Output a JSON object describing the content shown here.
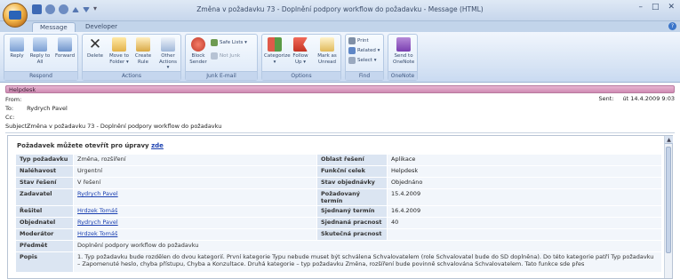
{
  "window": {
    "title": "Změna v požadavku 73 - Doplnění podpory workflow do požadavku - Message (HTML)",
    "controls": [
      "–",
      "□",
      "✕"
    ]
  },
  "tabs": [
    {
      "label": "Message"
    },
    {
      "label": "Developer"
    }
  ],
  "ribbon": {
    "respond": {
      "label": "Respond",
      "buttons": [
        {
          "label": "Reply"
        },
        {
          "label": "Reply to All"
        },
        {
          "label": "Forward"
        }
      ]
    },
    "actions": {
      "label": "Actions",
      "buttons": [
        {
          "label": "Delete"
        },
        {
          "label": "Move to Folder ▾"
        },
        {
          "label": "Create Rule"
        },
        {
          "label": "Other Actions ▾"
        }
      ]
    },
    "junk": {
      "label": "Junk E-mail",
      "block": "Block Sender",
      "safe_lists": "Safe Lists ▾",
      "not_junk": "Not Junk"
    },
    "options": {
      "label": "Options",
      "buttons": [
        {
          "label": "Categorize ▾"
        },
        {
          "label": "Follow Up ▾"
        },
        {
          "label": "Mark as Unread"
        }
      ]
    },
    "find": {
      "label": "Find",
      "print": "Print",
      "related": "Related ▾",
      "select": "Select ▾"
    },
    "onenote": {
      "label": "OneNote",
      "button": "Send to OneNote"
    }
  },
  "message": {
    "category_bar": "Helpdesk",
    "from_label": "From:",
    "from_value": "",
    "to_label": "To:",
    "to_value": "Rydrych Pavel",
    "cc_label": "Cc:",
    "subject_label": "Subject:",
    "subject_value": "Změna v požadavku 73 - Doplnění podpory workflow do požadavku",
    "sent_label": "Sent:",
    "sent_value": "út 14.4.2009 9:03"
  },
  "body": {
    "request_text": "Požadavek můžete otevřít pro úpravy",
    "request_link": "zde",
    "rows": [
      {
        "k1": "Typ požadavku",
        "v1": "Změna, rozšíření",
        "k2": "Oblast řešení",
        "v2": "Aplikace"
      },
      {
        "k1": "Naléhavost",
        "v1": "Urgentní",
        "k2": "Funkční celek",
        "v2": "Helpdesk"
      },
      {
        "k1": "Stav řešení",
        "v1": "V řešení",
        "k2": "Stav objednávky",
        "v2": "Objednáno"
      },
      {
        "k1": "Zadavatel",
        "v1": "Rydrych Pavel",
        "k2": "Požadovaný termín",
        "v2": "15.4.2009"
      },
      {
        "k1": "Řešitel",
        "v1": "Hrdzek Tomáš",
        "k2": "Sjednaný termín",
        "v2": "16.4.2009"
      },
      {
        "k1": "Objednatel",
        "v1": "Rydrych Pavel",
        "k2": "Sjednaná pracnost",
        "v2": "40"
      },
      {
        "k1": "Moderátor",
        "v1": "Hrdzek Tomáš",
        "k2": "Skutečná pracnost",
        "v2": ""
      }
    ],
    "predmet_label": "Předmět",
    "predmet_value": "Doplnění podpory workflow do požadavku",
    "popis_label": "Popis",
    "popis_value": "1. Typ požadavku bude rozdělen do dvou kategorií. První kategorie Typu nebude muset být schválena Schvalovatelem (role Schvalovatel bude do SD doplněna). Do této kategorie patří Typ požadavku – Zapomenuté heslo, chyba přístupu, Chyba a Konzultace. Druhá kategorie – typ požadavku Změna, rozšíření bude povinně schvalována Schvalovatelem. Tato funkce sde přes"
  }
}
